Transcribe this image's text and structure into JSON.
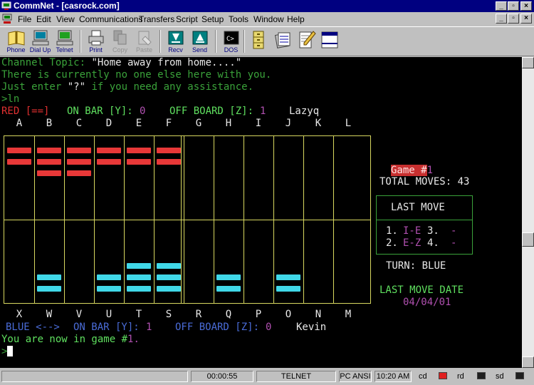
{
  "window": {
    "title": "CommNet - [casrock.com]"
  },
  "menus": [
    "File",
    "Edit",
    "View",
    "Communications",
    "Transfers",
    "Script",
    "Setup",
    "Tools",
    "Window",
    "Help"
  ],
  "toolbar": {
    "buttons": [
      {
        "label": "Phone",
        "icon": "phonebook-icon"
      },
      {
        "label": "Dial Up",
        "icon": "dialup-computer-icon"
      },
      {
        "label": "Telnet",
        "icon": "telnet-computer-icon"
      },
      {
        "label": "Print",
        "icon": "printer-icon"
      },
      {
        "label": "Copy",
        "icon": "copy-icon"
      },
      {
        "label": "Paste",
        "icon": "paste-icon"
      },
      {
        "label": "Recv",
        "icon": "receive-icon"
      },
      {
        "label": "Send",
        "icon": "send-icon"
      },
      {
        "label": "DOS",
        "icon": "dos-prompt-icon"
      },
      {
        "label": "",
        "icon": "file-cabinet-icon"
      },
      {
        "label": "",
        "icon": "notes-icon"
      },
      {
        "label": "",
        "icon": "editor-icon"
      },
      {
        "label": "",
        "icon": "window-icon"
      }
    ]
  },
  "terminal": {
    "topic_prefix": "Channel Topic: ",
    "topic_value": "\"Home away from home....\"",
    "line2": "There is currently no one else here with you.",
    "line3a": "Just enter ",
    "line3b": "\"?\"",
    "line3c": " if you need any assistance.",
    "line4": ">ln",
    "red_label": "RED [==]",
    "red_onbar_label": "ON BAR [Y]:",
    "red_onbar_value": "0",
    "red_offboard_label": "OFF BOARD [Z]:",
    "red_offboard_value": "1",
    "red_player": "Lazyq",
    "top_columns": [
      "A",
      "B",
      "C",
      "D",
      "E",
      "F",
      "G",
      "H",
      "I",
      "J",
      "K",
      "L"
    ],
    "bottom_columns": [
      "X",
      "W",
      "V",
      "U",
      "T",
      "S",
      "R",
      "Q",
      "P",
      "O",
      "N",
      "M"
    ],
    "top_stacks": [
      2,
      3,
      3,
      2,
      2,
      2,
      0,
      0,
      0,
      0,
      0,
      0
    ],
    "bottom_stacks": [
      0,
      2,
      0,
      2,
      3,
      3,
      0,
      2,
      0,
      2,
      0,
      0
    ],
    "blue_label": "BLUE <-->",
    "blue_onbar_label": "ON BAR [Y]:",
    "blue_onbar_value": "1",
    "blue_offboard_label": "OFF BOARD [Z]:",
    "blue_offboard_value": "0",
    "blue_player": "Kevin",
    "game_label": "Game #",
    "game_value": "1",
    "total_moves_label": "TOTAL MOVES:",
    "total_moves_value": "43",
    "last_move_title": "LAST MOVE",
    "move1_num": "1.",
    "move1_val": "I-E",
    "move3_num": "3.",
    "move3_val": "-",
    "move2_num": "2.",
    "move2_val": "E-Z",
    "move4_num": "4.",
    "move4_val": "-",
    "turn_label": "TURN:",
    "turn_value": "BLUE",
    "last_move_date_label": "LAST MOVE DATE",
    "last_move_date_value": "04/04/01",
    "game_msg_prefix": "You are now in game #",
    "game_msg_value": "1.",
    "prompt": ">"
  },
  "statusbar": {
    "timer": "00:00:55",
    "protocol": "TELNET",
    "charset": "PC ANSI",
    "clock": "10:20 AM",
    "cd_label": "cd",
    "rd_label": "rd",
    "sd_label": "sd"
  },
  "colors": {
    "red_piece": "#e83838",
    "blue_piece": "#40d8e8",
    "board_lines": "#d8d860",
    "title_bar": "#000080"
  }
}
